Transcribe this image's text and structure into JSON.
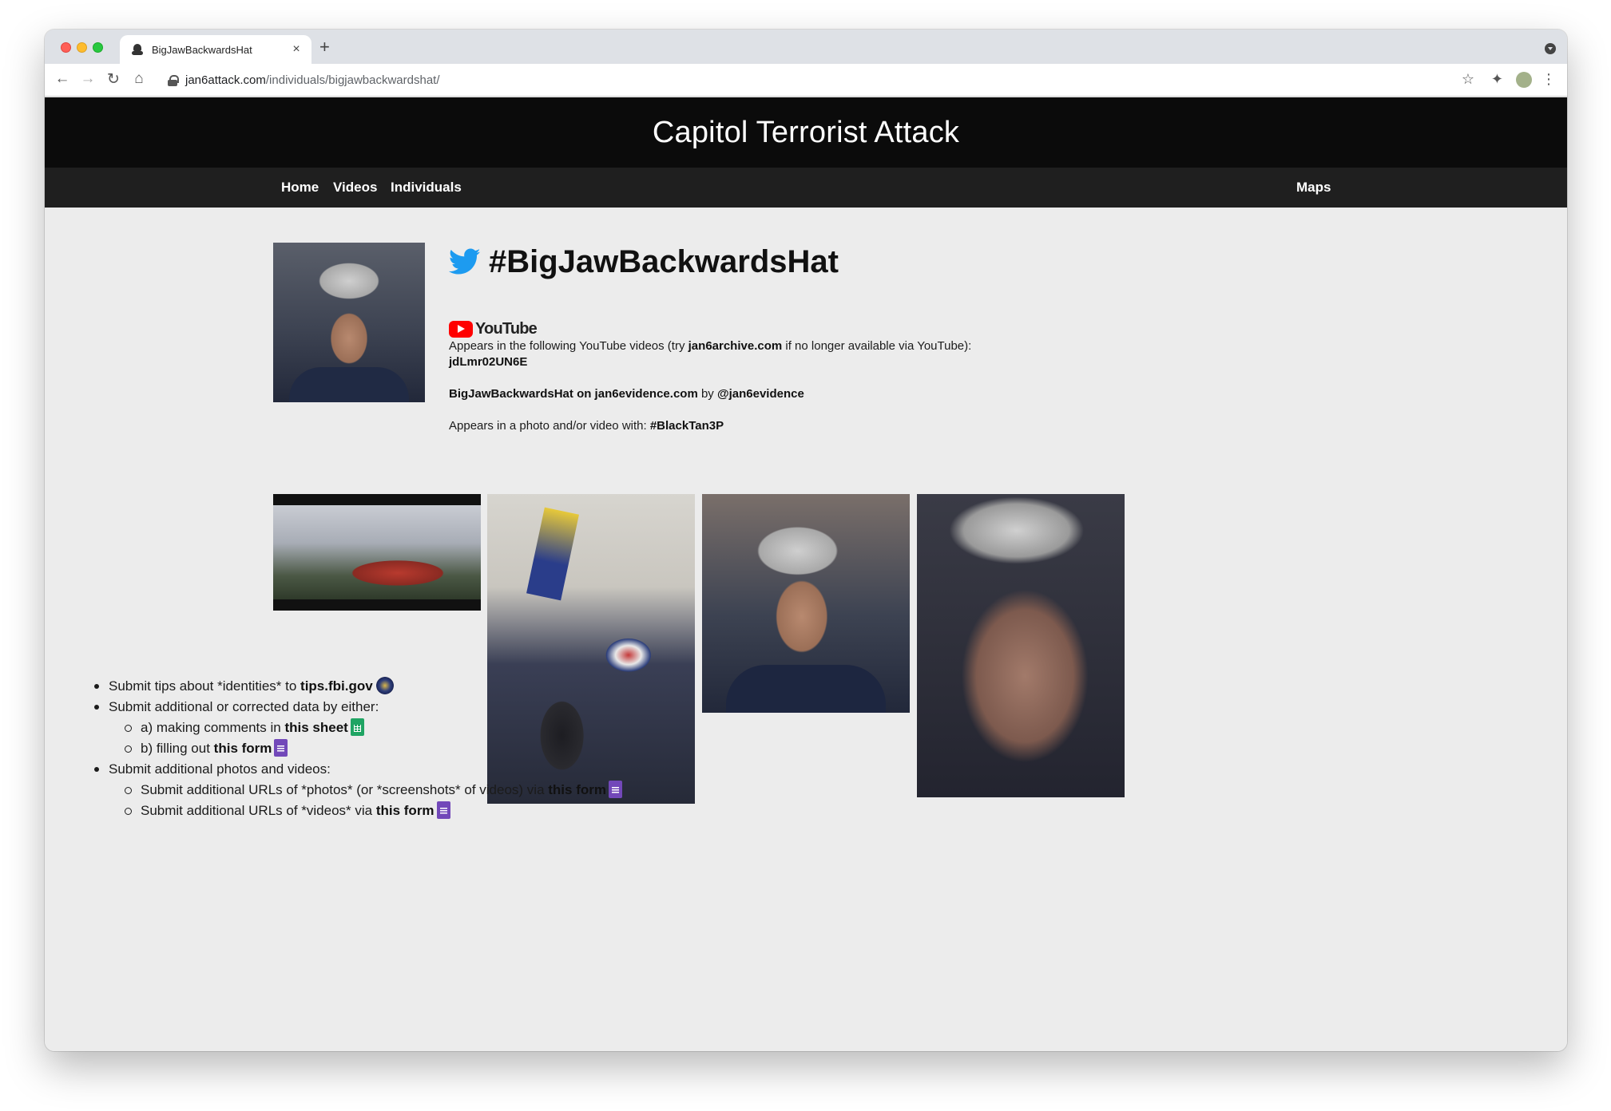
{
  "browser": {
    "tab_title": "BigJawBackwardsHat",
    "tab_close": "×",
    "new_tab": "+",
    "url_host": "jan6attack.com",
    "url_path": "/individuals/bigjawbackwardshat/",
    "back": "←",
    "forward": "→",
    "reload": "↻",
    "home": "⌂",
    "star": "☆",
    "extensions": "✦",
    "menu": "⋮"
  },
  "site": {
    "title": "Capitol Terrorist Attack",
    "nav": {
      "home": "Home",
      "videos": "Videos",
      "individuals": "Individuals",
      "maps": "Maps"
    }
  },
  "individual": {
    "handle": "#BigJawBackwardsHat",
    "youtube_word": "YouTube",
    "yt_pre": "Appears in the following YouTube videos (try ",
    "yt_archive_link": "jan6archive.com",
    "yt_post": " if no longer available via YouTube):",
    "video_id": "jdLmr02UN6E",
    "evidence_link": "BigJawBackwardsHat on jan6evidence.com",
    "evidence_by": " by ",
    "evidence_author": "@jan6evidence",
    "appears_with_label": "Appears in a photo and/or video with: ",
    "appears_with_link": "#BlackTan3P"
  },
  "tips": {
    "fbi_pre": "Submit tips about *identities* to ",
    "fbi_link": "tips.fbi.gov",
    "submit_data": "Submit additional or corrected data by either:",
    "sheet_pre": "a) making comments in ",
    "sheet_link": "this sheet",
    "form_pre": "b) filling out ",
    "form_link": "this form",
    "submit_media": "Submit additional photos and videos:",
    "photos_pre": "Submit additional URLs of *photos* (or *screenshots* of videos) via ",
    "photos_link": "this form",
    "videos_pre": "Submit additional URLs of *videos* via ",
    "videos_link": "this form"
  },
  "colors": {
    "header_bg": "#0b0b0b",
    "nav_bg": "#1f1f1f",
    "page_bg": "#ececec",
    "twitter": "#1d9bf0",
    "youtube": "#ff0000",
    "sheets": "#1fa463",
    "forms": "#7248b9"
  }
}
